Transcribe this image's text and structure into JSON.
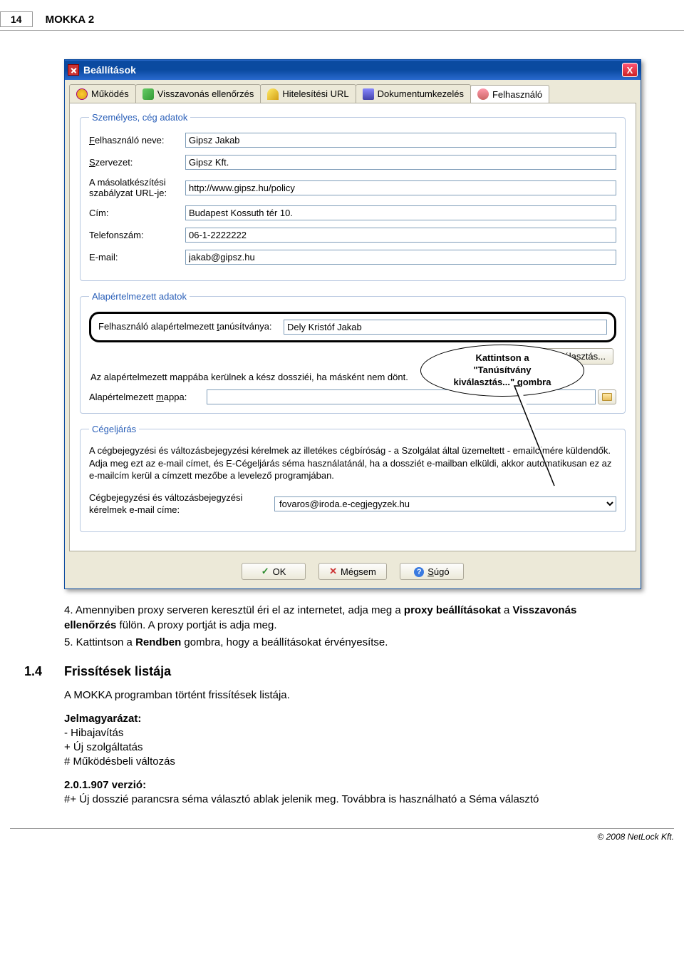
{
  "page": {
    "number": "14",
    "title": "MOKKA 2"
  },
  "dialog": {
    "title": "Beállítások",
    "close": "X",
    "tabs": [
      {
        "label": "Működés"
      },
      {
        "label": "Visszavonás ellenőrzés"
      },
      {
        "label": "Hitelesítési URL"
      },
      {
        "label": "Dokumentumkezelés"
      },
      {
        "label": "Felhasználó"
      }
    ],
    "group_personal": {
      "legend": "Személyes, cég adatok",
      "name_label": "Felhasználó neve:",
      "name_value": "Gipsz Jakab",
      "org_label": "Szervezet:",
      "org_value": "Gipsz Kft.",
      "policy_label": "A másolatkészítési szabályzat URL-je:",
      "policy_value": "http://www.gipsz.hu/policy",
      "address_label": "Cím:",
      "address_value": "Budapest Kossuth tér 10.",
      "phone_label": "Telefonszám:",
      "phone_value": "06-1-2222222",
      "email_label": "E-mail:",
      "email_value": "jakab@gipsz.hu"
    },
    "group_default": {
      "legend": "Alapértelmezett adatok",
      "cert_label": "Felhasználó alapértelmezett tanúsítványa:",
      "cert_value": "Dely Kristóf Jakab",
      "cert_button": "Tanúsítvány kiválasztás...",
      "note": "Az alapértelmezett mappába kerülnek a kész dossziéi, ha másként nem dönt.",
      "folder_label": "Alapértelmezett mappa:"
    },
    "group_proc": {
      "legend": "Cégeljárás",
      "desc": "A cégbejegyzési és változásbejegyzési kérelmek az illetékes cégbíróság - a Szolgálat által üzemeltett - emailcímére küldendők. Adja meg ezt az e-mail címet, és E-Cégeljárás séma használatánál, ha a dossziét e-mailban elküldi, akkor automatikusan ez az e-mailcím kerül a címzett mezőbe a levelező programjában.",
      "email_label": "Cégbejegyzési és változásbejegyzési kérelmek e-mail címe:",
      "email_value": "fovaros@iroda.e-cegjegyzek.hu"
    },
    "buttons": {
      "ok": "OK",
      "cancel": "Mégsem",
      "help": "Súgó"
    }
  },
  "callout": {
    "line1": "Kattintson a",
    "line2": "\"Tanúsítvány",
    "line3": "kiválasztás...\" gombra"
  },
  "body": {
    "p4": "4. Amennyiben proxy serveren keresztül éri el az internetet, adja meg a ",
    "p4b": "proxy beállításokat",
    "p4c": " a ",
    "p4d": "Visszavonás ellenőrzés",
    "p4e": " fülön. A proxy portját is adja meg.",
    "p5": "5. Kattintson a ",
    "p5b": "Rendben",
    "p5c": " gombra, hogy a beállításokat érvényesítse.",
    "sec_num": "1.4",
    "sec_title": "Frissítések listája",
    "sub1": "A MOKKA programban történt frissítések listája.",
    "leg_title": "Jelmagyarázat:",
    "leg1": "- Hibajavítás",
    "leg2": "+ Új szolgáltatás",
    "leg3": "# Működésbeli változás",
    "ver_title": "2.0.1.907 verzió:",
    "ver_line": "#+ Új dosszié parancsra séma választó ablak jelenik meg. Továbbra is használható a Séma választó"
  },
  "footer": "© 2008 NetLock Kft."
}
